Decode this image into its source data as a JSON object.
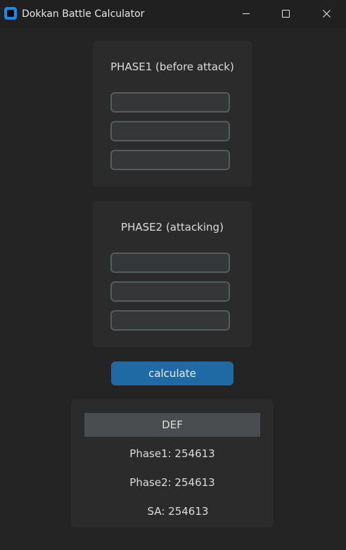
{
  "window": {
    "title": "Dokkan Battle Calculator"
  },
  "phase1": {
    "title": "PHASE1 (before attack)",
    "inputs": [
      {
        "value": "",
        "placeholder": ""
      },
      {
        "value": "",
        "placeholder": ""
      },
      {
        "value": "",
        "placeholder": ""
      }
    ]
  },
  "phase2": {
    "title": "PHASE2 (attacking)",
    "inputs": [
      {
        "value": "",
        "placeholder": ""
      },
      {
        "value": "",
        "placeholder": ""
      },
      {
        "value": "",
        "placeholder": ""
      }
    ]
  },
  "calculate_label": "calculate",
  "results": {
    "header": "DEF",
    "phase1": "Phase1: 254613",
    "phase2": "Phase2: 254613",
    "sa": "SA: 254613"
  },
  "colors": {
    "background": "#242424",
    "panel": "#2b2b2b",
    "input_border": "#565b5e",
    "button": "#1f6aa5",
    "header_bg": "#4a4d50",
    "app_icon": "#1e88e5"
  },
  "icons": {
    "app": "app-icon",
    "minimize": "minimize-icon",
    "maximize": "maximize-icon",
    "close": "close-icon"
  }
}
